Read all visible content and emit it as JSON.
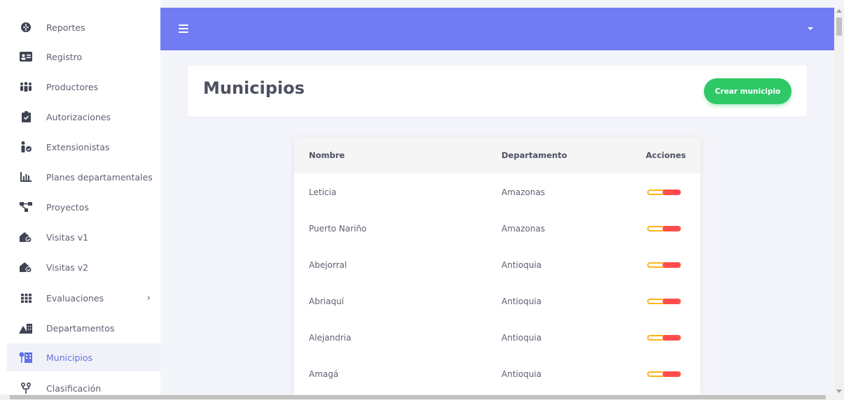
{
  "sidebar": {
    "items": [
      {
        "label": "Reportes",
        "icon": "dashboard-icon"
      },
      {
        "label": "Registro",
        "icon": "id-card-icon"
      },
      {
        "label": "Productores",
        "icon": "users-icon"
      },
      {
        "label": "Autorizaciones",
        "icon": "clipboard-check-icon"
      },
      {
        "label": "Extensionistas",
        "icon": "user-check-icon"
      },
      {
        "label": "Planes departamentales",
        "icon": "bar-chart-icon"
      },
      {
        "label": "Proyectos",
        "icon": "project-diagram-icon"
      },
      {
        "label": "Visitas v1",
        "icon": "house-check-icon"
      },
      {
        "label": "Visitas v2",
        "icon": "house-check-icon"
      },
      {
        "label": "Evaluaciones",
        "icon": "grid-icon"
      },
      {
        "label": "Departamentos",
        "icon": "mountain-city-icon"
      },
      {
        "label": "Municipios",
        "icon": "city-tree-icon"
      },
      {
        "label": "Clasificación",
        "icon": "branch-icon"
      }
    ],
    "active": "Municipios"
  },
  "header": {
    "title": "Municipios",
    "create_label": "Crear municipio"
  },
  "table": {
    "columns": [
      "Nombre",
      "Departamento",
      "Acciones"
    ],
    "rows": [
      {
        "nombre": "Leticia",
        "departamento": "Amazonas"
      },
      {
        "nombre": "Puerto Nariño",
        "departamento": "Amazonas"
      },
      {
        "nombre": "Abejorral",
        "departamento": "Antioquia"
      },
      {
        "nombre": "Abriaquí",
        "departamento": "Antioquia"
      },
      {
        "nombre": "Alejandria",
        "departamento": "Antioquia"
      },
      {
        "nombre": "Amagá",
        "departamento": "Antioquia"
      }
    ]
  },
  "colors": {
    "topbar": "#717cf3",
    "accent": "#6272e8",
    "create_button": "#2fc867",
    "toggle_border": "#ffb31a",
    "toggle_knob": "#ff4d4d"
  }
}
